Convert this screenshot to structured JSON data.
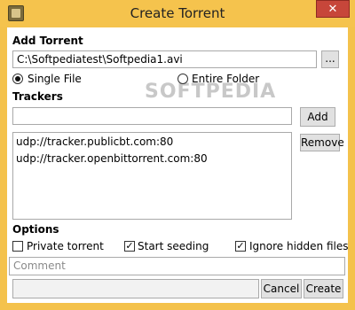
{
  "window": {
    "title": "Create Torrent",
    "close_symbol": "✕"
  },
  "add_torrent": {
    "heading": "Add Torrent",
    "path_value": "C:\\Softpediatest\\Softpedia1.avi",
    "browse_label": "...",
    "single_file_label": "Single File",
    "entire_folder_label": "Entire Folder",
    "selected_mode": "single_file"
  },
  "trackers": {
    "heading": "Trackers",
    "input_value": "",
    "add_label": "Add",
    "remove_label": "Remove",
    "items": [
      "udp://tracker.publicbt.com:80",
      "udp://tracker.openbittorrent.com:80"
    ]
  },
  "options": {
    "heading": "Options",
    "private_torrent": {
      "label": "Private torrent",
      "checked": false
    },
    "start_seeding": {
      "label": "Start seeding",
      "checked": true
    },
    "ignore_hidden": {
      "label": "Ignore hidden files",
      "checked": true
    }
  },
  "comment": {
    "placeholder": "Comment"
  },
  "footer": {
    "cancel_label": "Cancel",
    "create_label": "Create"
  },
  "watermark": "SOFTPEDIA"
}
